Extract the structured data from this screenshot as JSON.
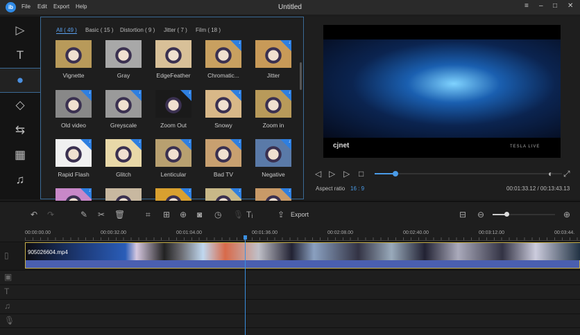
{
  "app": {
    "logo": "ib",
    "title": "Untitled",
    "menu": [
      "File",
      "Edit",
      "Export",
      "Help"
    ]
  },
  "window_controls": {
    "menu": "≡",
    "minimize": "–",
    "maximize": "□",
    "close": "✕"
  },
  "sidebar": [
    {
      "icon": "media-icon",
      "glyph": "▷"
    },
    {
      "icon": "text-icon",
      "glyph": "T"
    },
    {
      "icon": "filters-icon",
      "glyph": "●",
      "selected": true
    },
    {
      "icon": "overlay-icon",
      "glyph": "◇"
    },
    {
      "icon": "transition-icon",
      "glyph": "⇆"
    },
    {
      "icon": "element-icon",
      "glyph": "▦"
    },
    {
      "icon": "music-icon",
      "glyph": "♫"
    }
  ],
  "effects": {
    "tabs": [
      "All ( 49 )",
      "Basic ( 15 )",
      "Distortion ( 9 )",
      "Jitter ( 7 )",
      "Film ( 18 )"
    ],
    "active_tab": 0,
    "items": [
      {
        "name": "Vignette",
        "color": "#b89a5a",
        "download": false
      },
      {
        "name": "Gray",
        "color": "#a8a8a8",
        "download": false
      },
      {
        "name": "EdgeFeather",
        "color": "#d8c098",
        "download": false
      },
      {
        "name": "Chromatic...",
        "color": "#c8a060",
        "download": true
      },
      {
        "name": "Jitter",
        "color": "#c89a58",
        "download": true
      },
      {
        "name": "Old video",
        "color": "#888888",
        "download": true
      },
      {
        "name": "Greyscale",
        "color": "#9a9a9a",
        "download": true
      },
      {
        "name": "Zoom Out",
        "color": "#1a1a1a",
        "download": true
      },
      {
        "name": "Snowy",
        "color": "#d8b888",
        "download": true
      },
      {
        "name": "Zoom in",
        "color": "#b89a5a",
        "download": true
      },
      {
        "name": "Rapid Flash",
        "color": "#f0f0f0",
        "download": true
      },
      {
        "name": "Glitch",
        "color": "#e8d8a8",
        "download": true
      },
      {
        "name": "Lenticular",
        "color": "#b8a070",
        "download": true
      },
      {
        "name": "Bad TV",
        "color": "#c8a070",
        "download": true
      },
      {
        "name": "Negative",
        "color": "#5a7aa8",
        "download": true
      },
      {
        "name": "",
        "color": "#c888c8",
        "download": true
      },
      {
        "name": "",
        "color": "#c8b8a0",
        "download": false
      },
      {
        "name": "",
        "color": "#d8a030",
        "download": true
      },
      {
        "name": "",
        "color": "#c8b888",
        "download": true
      },
      {
        "name": "",
        "color": "#c89a68",
        "download": true
      }
    ]
  },
  "preview": {
    "watermark": "cjnet",
    "brand": "TESLA LIVE",
    "aspect_label": "Aspect ratio",
    "aspect_value": "16 : 9",
    "time": "00:01:33.12 / 00:13:43.13",
    "progress": 0.11
  },
  "toolbar": {
    "export_label": "Export",
    "zoom_level": 0.22
  },
  "timeline": {
    "ticks": [
      "00:00:00.00",
      "00:00:32.00",
      "00:01:04.00",
      "00:01:36.00",
      "00:02:08.00",
      "00:02:40.00",
      "00:03:12.00",
      "00:03:44."
    ],
    "clip_name": "905026604.mp4"
  },
  "colors": {
    "accent": "#3a8fe0",
    "clip_border": "#c7b04a",
    "clip_audio": "#4a5fb0"
  }
}
